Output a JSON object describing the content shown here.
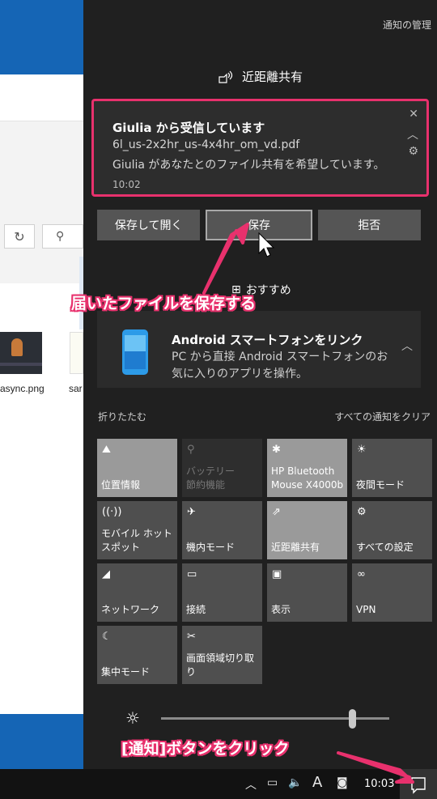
{
  "explorer": {
    "file1": "async.png",
    "file2": "sar"
  },
  "action_center": {
    "manage_label": "通知の管理",
    "group_title": "近距離共有",
    "toast": {
      "title": "Giulia から受信しています",
      "file": "6l_us-2x2hr_us-4x4hr_om_vd.pdf",
      "message": "Giulia があなたとのファイル共有を希望しています。",
      "time": "10:02"
    },
    "actions": [
      "保存して開く",
      "保存",
      "拒否"
    ],
    "recommended_label": "おすすめ",
    "link_card": {
      "title": "Android スマートフォンをリンク",
      "description": "PC から直接 Android スマートフォンのお気に入りのアプリを操作。"
    },
    "collapse_label": "折りたたむ",
    "clear_all_label": "すべての通知をクリア",
    "tiles": [
      {
        "label": "位置情報",
        "icon": "location-icon",
        "state": "on"
      },
      {
        "label": "バッテリー\n節約機能",
        "icon": "battery-saver-icon",
        "state": "disabled"
      },
      {
        "label": "HP Bluetooth Mouse X4000b",
        "icon": "bluetooth-icon",
        "state": "on"
      },
      {
        "label": "夜間モード",
        "icon": "night-light-icon",
        "state": "off"
      },
      {
        "label": "モバイル ホットスポット",
        "icon": "hotspot-icon",
        "state": "off"
      },
      {
        "label": "機内モード",
        "icon": "airplane-icon",
        "state": "off"
      },
      {
        "label": "近距離共有",
        "icon": "nearby-share-icon",
        "state": "on"
      },
      {
        "label": "すべての設定",
        "icon": "settings-icon",
        "state": "off"
      },
      {
        "label": "ネットワーク",
        "icon": "network-icon",
        "state": "off"
      },
      {
        "label": "接続",
        "icon": "connect-icon",
        "state": "off"
      },
      {
        "label": "表示",
        "icon": "project-icon",
        "state": "off"
      },
      {
        "label": "VPN",
        "icon": "vpn-icon",
        "state": "off"
      },
      {
        "label": "集中モード",
        "icon": "focus-assist-icon",
        "state": "off"
      },
      {
        "label": "画面領域切り取り",
        "icon": "snip-icon",
        "state": "off"
      }
    ],
    "brightness_level": 0.85
  },
  "annotations": {
    "save_hint": "届いたファイルを保存する",
    "notify_hint": "[通知]ボタンをクリック"
  },
  "taskbar": {
    "input_indicator": "A",
    "clock": "10:03"
  },
  "colors": {
    "accent": "#e8316d",
    "panel": "#202020",
    "tile_on": "#9a9a9a",
    "tile_off": "#4f4f4f"
  }
}
